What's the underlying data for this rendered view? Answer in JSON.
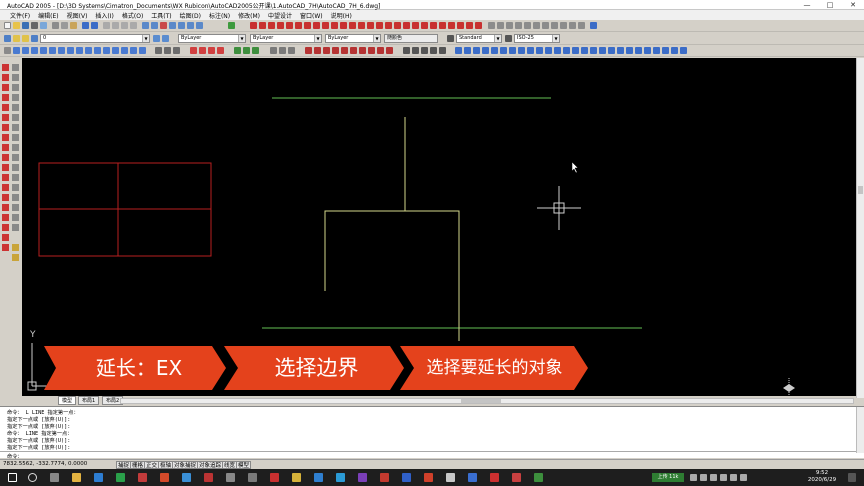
{
  "window": {
    "title": "AutoCAD 2005 - [D:\\3D Systems\\Cimatron_Documents\\WX Rubicon\\AutoCAD2005公开课\\1.AutoCAD_7H\\AutoCAD_7H_6.dwg]",
    "minimize": "—",
    "maximize": "□",
    "close": "✕"
  },
  "menu": [
    "文件(F)",
    "编辑(E)",
    "视图(V)",
    "插入(I)",
    "格式(O)",
    "工具(T)",
    "绘图(D)",
    "标注(N)",
    "修改(M)",
    "中望设计",
    "窗口(W)",
    "说明(H)"
  ],
  "toolbar": {
    "layer_value": "0",
    "color_value": "ByLayer",
    "linetype_value": "ByLayer",
    "lineweight_value": "ByLayer",
    "plotstyle_value": "随颜色",
    "textstyle_value": "Standard",
    "dimstyle_value": "ISO-25"
  },
  "tabs": [
    "模型",
    "布局1",
    "布局2"
  ],
  "ucs": {
    "y_label": "Y",
    "x_label": "X"
  },
  "banner": {
    "step1": "延长：EX",
    "step2": "选择边界",
    "step3": "选择要延长的对象",
    "color": "#e4421c"
  },
  "command_lines": [
    "命令： L LINE 指定第一点：",
    "指定下一点或 [放弃(U)]:",
    "指定下一点或 [放弃(U)]:",
    "命令： LINE 指定第一点：",
    "指定下一点或 [放弃(U)]:",
    "指定下一点或 [放弃(U)]:"
  ],
  "command_prompt": "命令：",
  "status": {
    "coords": "7832.5562, -332.7774, 0.0000",
    "buttons": [
      "捕捉",
      "栅格",
      "正交",
      "极轴",
      "对象捕捉",
      "对象追踪",
      "线宽",
      "模型"
    ]
  },
  "taskbar": {
    "time": "9:52",
    "date": "2020/6/29",
    "tray_text": "上传 11k"
  },
  "colors": {
    "drawing_bg": "#000000",
    "green_line": "#4f9a43",
    "yellow_line": "#d4d88c",
    "red_rect": "#b91f1f",
    "crosshair": "#d0d0d0"
  }
}
